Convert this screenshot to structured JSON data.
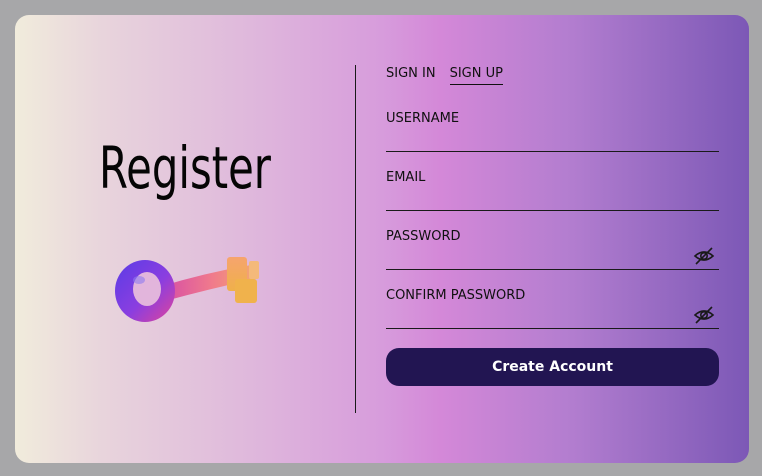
{
  "left": {
    "title": "Register",
    "icon": "key-icon"
  },
  "tabs": [
    {
      "label": "SIGN IN",
      "active": false
    },
    {
      "label": "SIGN UP",
      "active": true
    }
  ],
  "fields": {
    "username": {
      "label": "USERNAME",
      "value": ""
    },
    "email": {
      "label": "EMAIL",
      "value": ""
    },
    "password": {
      "label": "PASSWORD",
      "value": "",
      "toggle_icon": "eye-off-icon"
    },
    "confirm_password": {
      "label": "CONFIRM PASSWORD",
      "value": "",
      "toggle_icon": "eye-off-icon"
    }
  },
  "actions": {
    "create_label": "Create Account"
  },
  "colors": {
    "background": "#a7a7a9",
    "button": "#221552",
    "gradient_start": "#f1ecdc",
    "gradient_mid": "#d488d8",
    "gradient_end": "#7c58b6"
  }
}
